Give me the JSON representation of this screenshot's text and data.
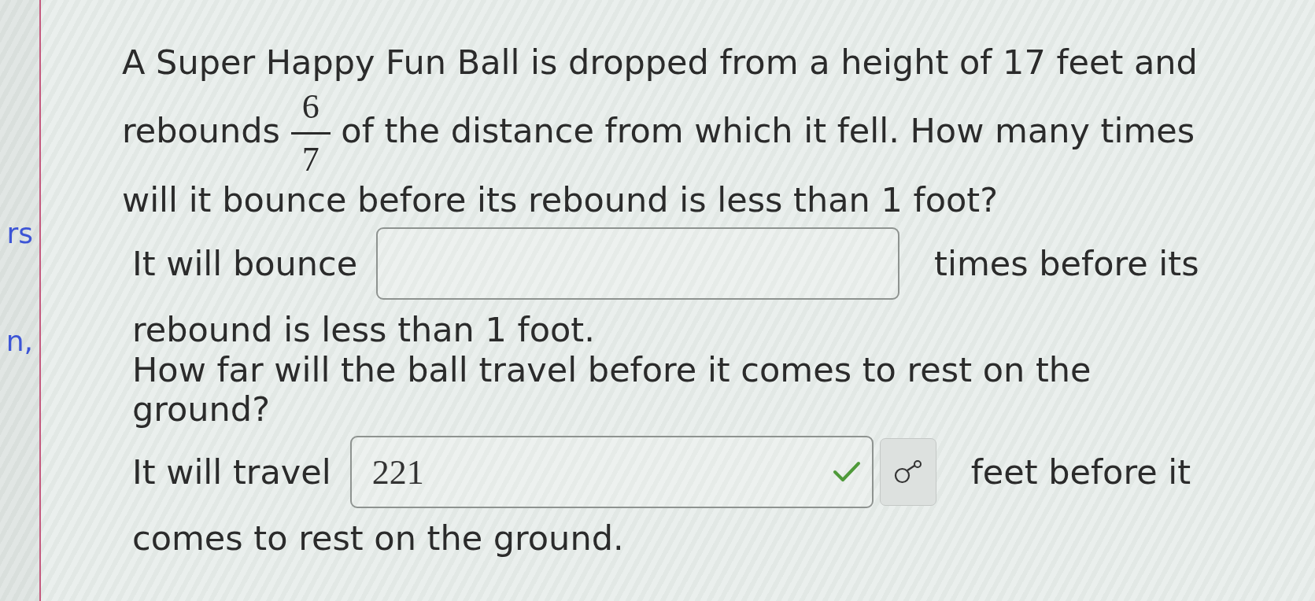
{
  "sidebar_fragments": [
    "rs",
    "n,"
  ],
  "question": {
    "text_before": "A Super Happy Fun Ball is dropped from a height of 17 feet and rebounds",
    "fraction": {
      "numerator": "6",
      "denominator": "7"
    },
    "text_after": "of the distance from which it fell. How many times will it bounce before its rebound is less than 1 foot?"
  },
  "parts": [
    {
      "lead_in": "It will bounce",
      "correct": false,
      "tool_button": false,
      "trailing_lines": [
        "times before its",
        "rebound is less than 1 foot."
      ]
    },
    {
      "question": "How far will the ball travel before it comes to rest on the ground?",
      "lead_in": "It will travel",
      "value": "221",
      "correct": true,
      "tool_button": true,
      "trailing_lines": [
        "feet before it",
        "comes to rest on the ground."
      ]
    }
  ]
}
